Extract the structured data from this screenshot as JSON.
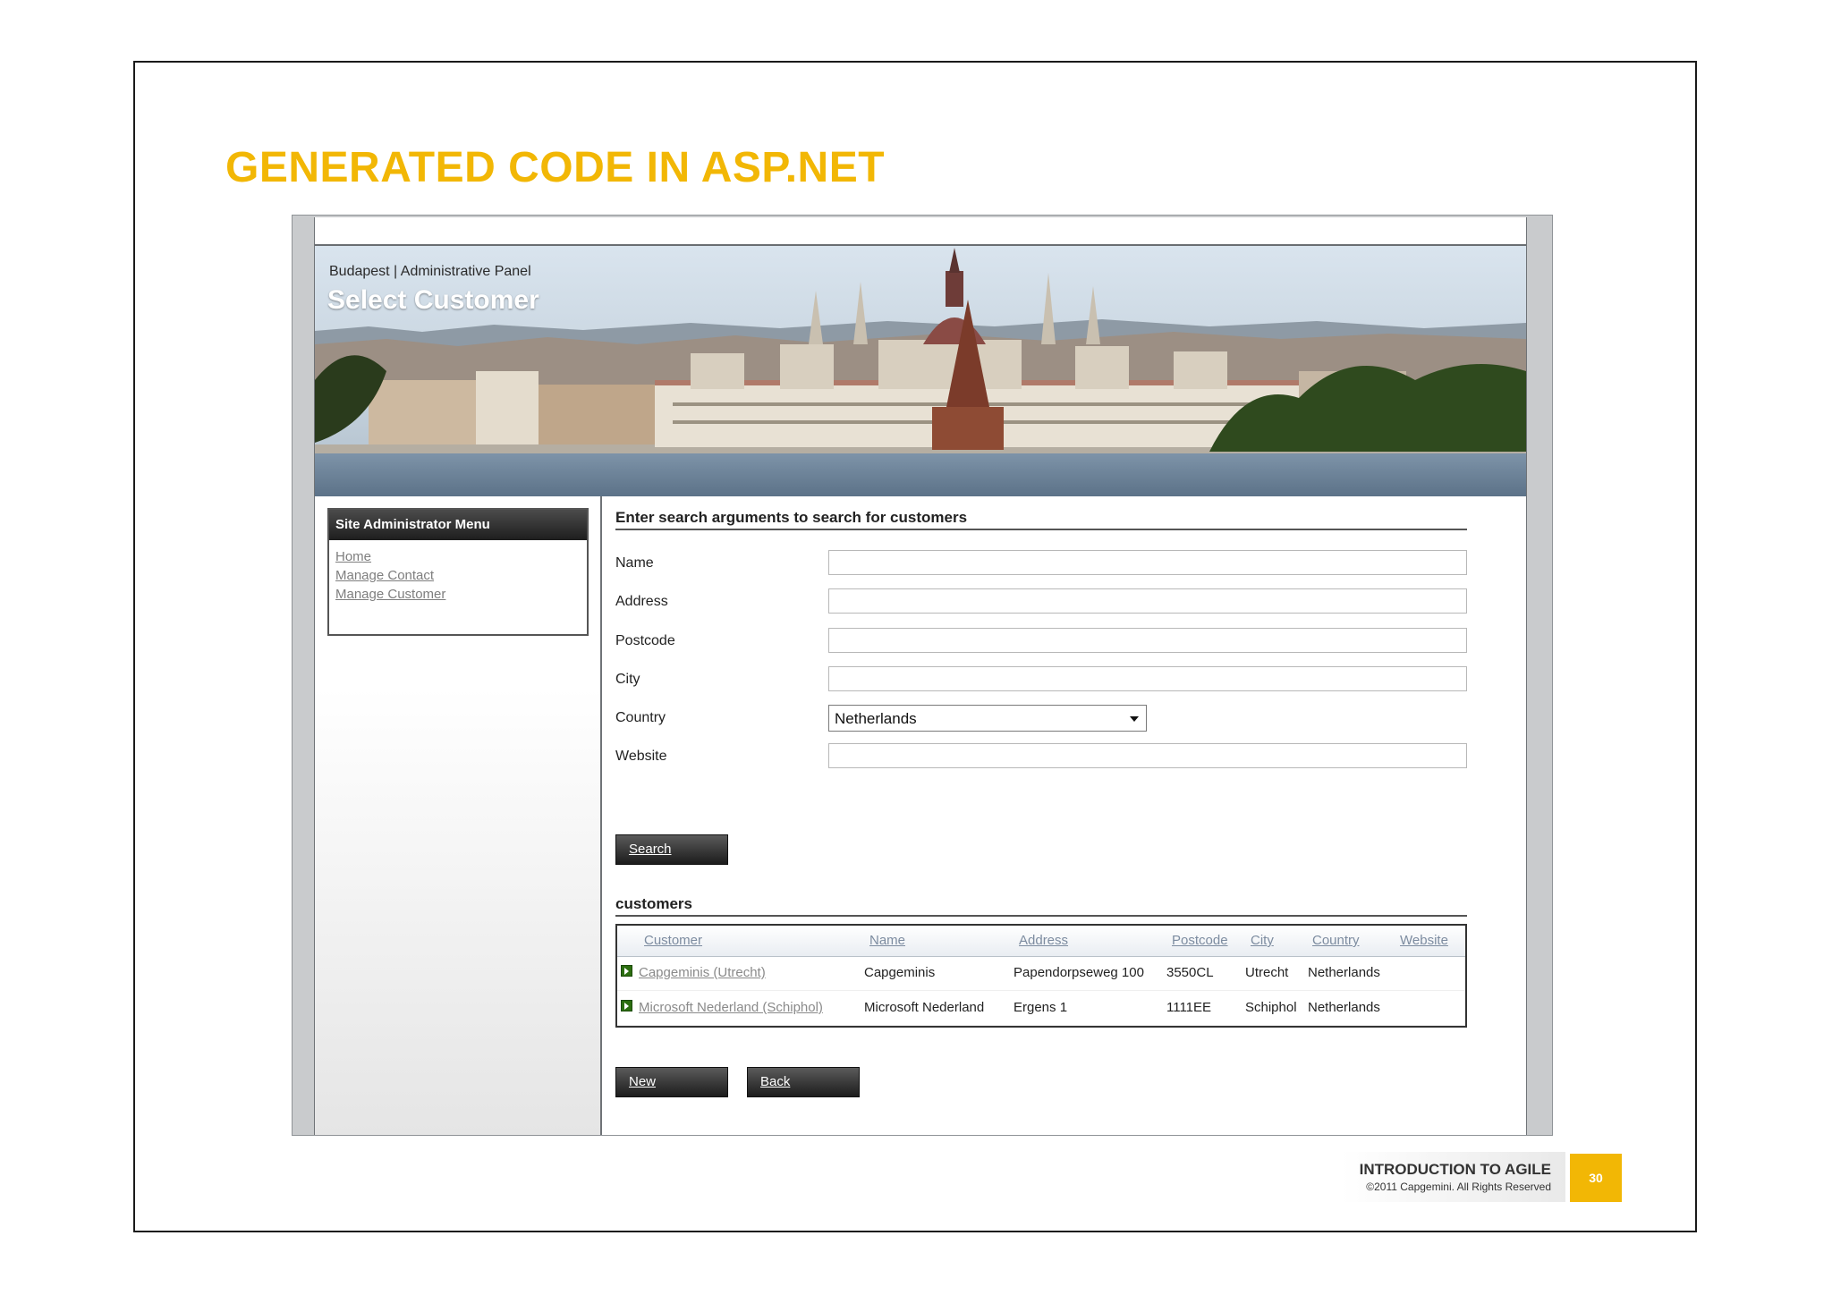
{
  "slide": {
    "title": "GENERATED CODE IN ASP.NET",
    "footer_title": "INTRODUCTION TO AGILE",
    "footer_copyright": "©2011 Capgemini. All Rights Reserved",
    "page_number": "30",
    "accent_color": "#f2b705"
  },
  "app": {
    "breadcrumb": "Budapest | Administrative Panel",
    "page_title": "Select Customer",
    "banner_image": "budapest-parliament-panorama"
  },
  "sidebar": {
    "menu_title": "Site Administrator Menu",
    "items": [
      {
        "label": "Home"
      },
      {
        "label": "Manage Contact"
      },
      {
        "label": "Manage Customer"
      }
    ]
  },
  "search": {
    "heading": "Enter search arguments to search for customers",
    "fields": {
      "name": {
        "label": "Name",
        "value": ""
      },
      "address": {
        "label": "Address",
        "value": ""
      },
      "postcode": {
        "label": "Postcode",
        "value": ""
      },
      "city": {
        "label": "City",
        "value": ""
      },
      "country": {
        "label": "Country",
        "value": "Netherlands"
      },
      "website": {
        "label": "Website",
        "value": ""
      }
    },
    "search_button": "Search"
  },
  "results": {
    "heading": "customers",
    "columns": [
      "Customer",
      "Name",
      "Address",
      "Postcode",
      "City",
      "Country",
      "Website"
    ],
    "rows": [
      {
        "customer": "Capgeminis (Utrecht)",
        "name": "Capgeminis",
        "address": "Papendorpseweg 100",
        "postcode": "3550CL",
        "city": "Utrecht",
        "country": "Netherlands",
        "website": ""
      },
      {
        "customer": "Microsoft Nederland (Schiphol)",
        "name": "Microsoft Nederland",
        "address": "Ergens 1",
        "postcode": "1111EE",
        "city": "Schiphol",
        "country": "Netherlands",
        "website": ""
      }
    ],
    "new_button": "New",
    "back_button": "Back"
  }
}
